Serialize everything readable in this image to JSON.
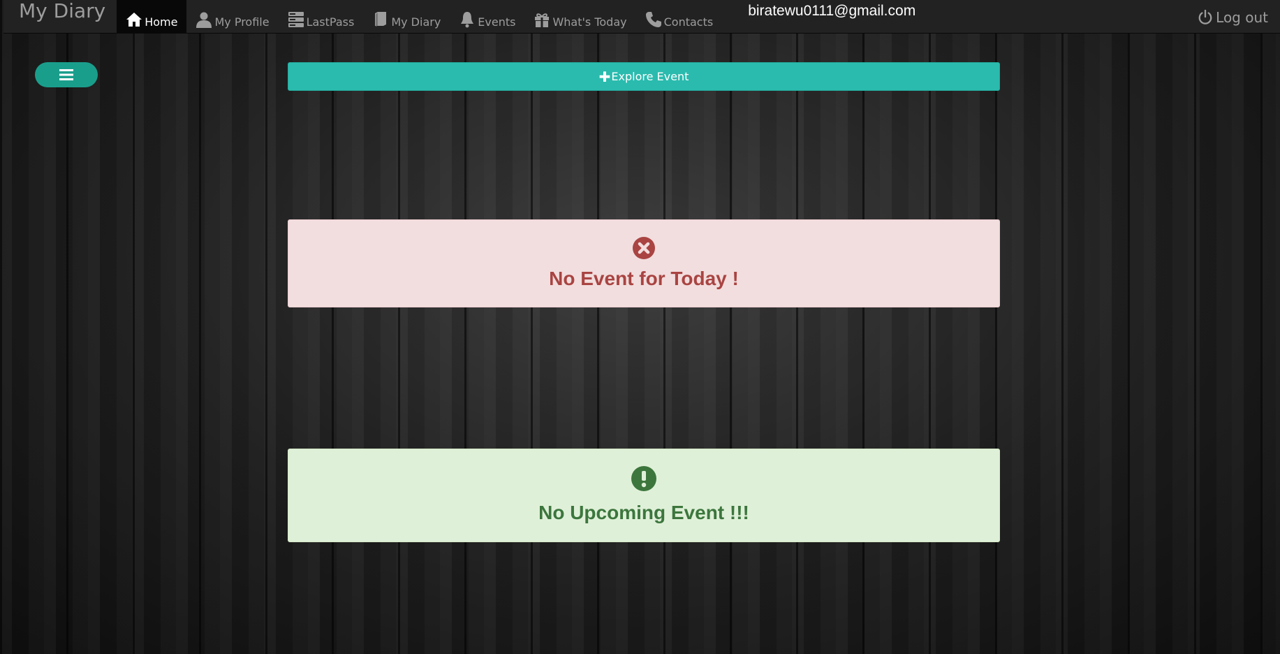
{
  "brand": "My Diary",
  "nav": {
    "items": [
      {
        "label": "Home",
        "icon": "home-icon"
      },
      {
        "label": "My Profile",
        "icon": "user-icon"
      },
      {
        "label": "LastPass",
        "icon": "server-icon"
      },
      {
        "label": "My Diary",
        "icon": "book-icon"
      },
      {
        "label": "Events",
        "icon": "bell-icon"
      },
      {
        "label": "What's Today",
        "icon": "gift-icon"
      },
      {
        "label": "Contacts",
        "icon": "phone-icon"
      }
    ],
    "active": "Home",
    "user_email": "biratewu0111@gmail.com",
    "logout_label": "Log out"
  },
  "sidebar_toggle": {
    "icon": "hamburger-menu-icon"
  },
  "explore_button": {
    "label": "Explore Event",
    "icon": "plus-icon"
  },
  "today_panel": {
    "message": "No Event for Today !",
    "icon": "remove-circle-icon"
  },
  "upcoming_panel": {
    "message": "No Upcoming Event !!!",
    "icon": "exclamation-circle-icon"
  },
  "colors": {
    "navbar_bg": "#222222",
    "accent": "#2abbae",
    "danger_bg": "#f2dede",
    "danger_text": "#a94442",
    "success_bg": "#dff0d8",
    "success_text": "#3c763d"
  }
}
